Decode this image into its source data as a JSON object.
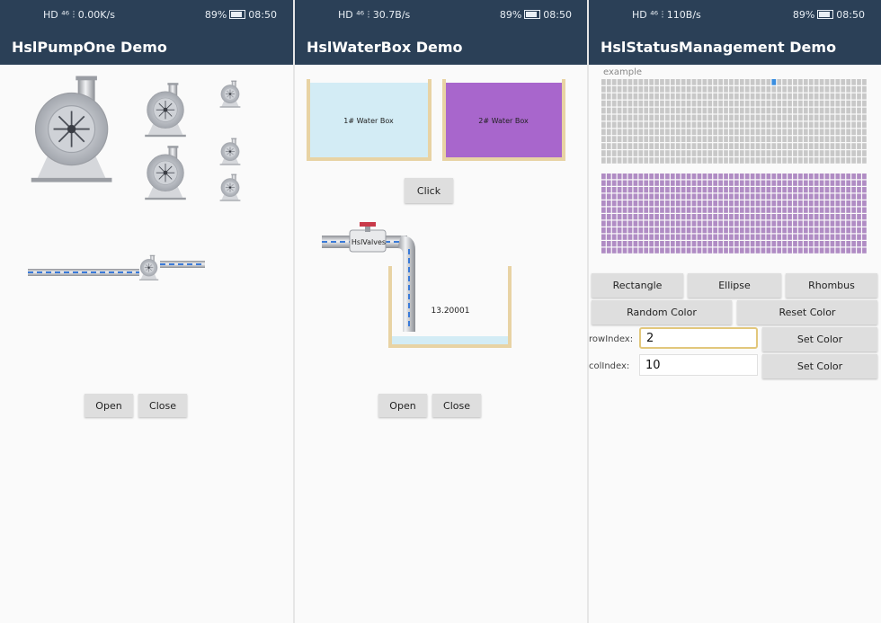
{
  "status_bars": [
    {
      "left": "HD ⁴⁶ ⫶ 0.00K/s",
      "right_battery": "89%",
      "time": "08:50"
    },
    {
      "left": "HD ⁴⁶ ⫶ 30.7B/s",
      "right_battery": "89%",
      "time": "08:50"
    },
    {
      "left": "HD ⁴⁶ ⫶ 110B/s",
      "right_battery": "89%",
      "time": "08:50"
    }
  ],
  "panel1": {
    "title": "HslPumpOne Demo",
    "open_label": "Open",
    "close_label": "Close"
  },
  "panel2": {
    "title": "HslWaterBox Demo",
    "box1_label": "1# Water Box",
    "box2_label": "2# Water Box",
    "click_label": "Click",
    "valve_label": "HslValves",
    "tank_value": "13.20001",
    "open_label": "Open",
    "close_label": "Close",
    "colors": {
      "box1": "#d3ecf5",
      "box2": "#a866cc",
      "tank_frame": "#e8d3a4"
    }
  },
  "panel3": {
    "title": "HslStatusManagement Demo",
    "example_label": "example",
    "grid_rows": 12,
    "grid_cols": 50,
    "grid2_rows": 12,
    "grid2_cols": 50,
    "highlight_cell": {
      "row": 0,
      "col": 32
    },
    "rectangle_label": "Rectangle",
    "ellipse_label": "Ellipse",
    "rhombus_label": "Rhombus",
    "random_color_label": "Random Color",
    "reset_color_label": "Reset Color",
    "row_index_label": "rowIndex:",
    "row_index_value": "2",
    "col_index_label": "colIndex:",
    "col_index_value": "10",
    "set_color_label": "Set Color",
    "colors": {
      "grid": "#c8c8c8",
      "grid2": "#b08cc4",
      "highlight": "#3a8ee0"
    }
  }
}
